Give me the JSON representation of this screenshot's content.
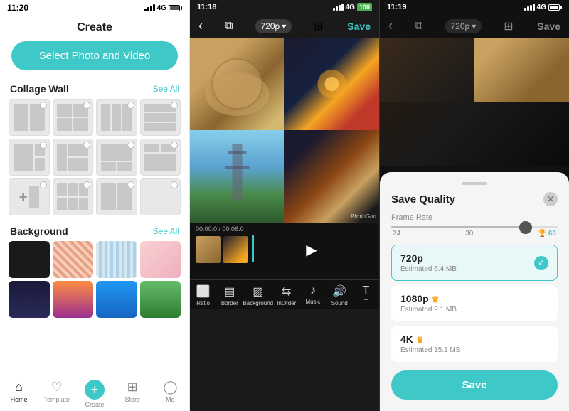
{
  "panel1": {
    "status": {
      "time": "11:20",
      "network": "4G"
    },
    "title": "Create",
    "select_btn": "Select Photo and Video",
    "collage_wall": {
      "label": "Collage Wall",
      "see_all": "See All"
    },
    "background": {
      "label": "Background",
      "see_all": "See All"
    },
    "nav": [
      {
        "label": "Home",
        "icon": "⌂"
      },
      {
        "label": "Template",
        "icon": "♡"
      },
      {
        "label": "Create",
        "icon": "+",
        "active": true
      },
      {
        "label": "Store",
        "icon": "⊞"
      },
      {
        "label": "Me",
        "icon": "◯"
      }
    ]
  },
  "panel2": {
    "status": {
      "time": "11:18",
      "network": "4G",
      "battery": "100"
    },
    "quality": "720p",
    "save_label": "Save",
    "timeline": {
      "current": "00:00.0",
      "total": "00:06.0"
    },
    "tools": [
      "Ratio",
      "Border",
      "Background",
      "InOrder",
      "Music",
      "Sound",
      "T"
    ]
  },
  "panel3": {
    "status": {
      "time": "11:19",
      "network": "4G"
    },
    "quality": "720p",
    "save_label": "Save",
    "modal": {
      "title": "Save Quality",
      "frame_rate_label": "Frame Rate",
      "slider_min": "24",
      "slider_mid": "30",
      "slider_max": "60",
      "options": [
        {
          "name": "720p",
          "size": "Estimated 6.4 MB",
          "selected": true
        },
        {
          "name": "1080p",
          "size": "Estimated 9.1 MB",
          "selected": false,
          "premium": true
        },
        {
          "name": "4K",
          "size": "Estimated 15.1 MB",
          "selected": false,
          "premium": true
        }
      ],
      "save_btn": "Save"
    }
  }
}
